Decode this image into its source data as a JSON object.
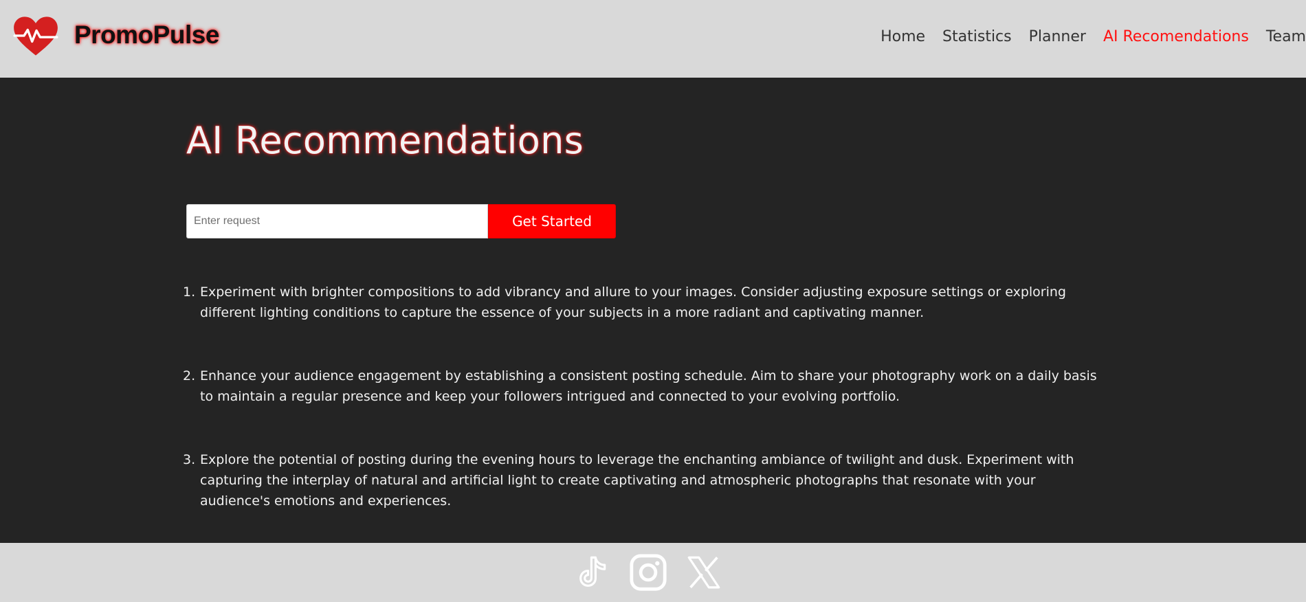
{
  "header": {
    "brand": "PromoPulse",
    "nav": [
      {
        "label": "Home",
        "active": false
      },
      {
        "label": "Statistics",
        "active": false
      },
      {
        "label": "Planner",
        "active": false
      },
      {
        "label": "AI Recomendations",
        "active": true
      },
      {
        "label": "Team",
        "active": false
      }
    ]
  },
  "main": {
    "title": "AI Recommendations",
    "request_placeholder": "Enter request",
    "request_value": "",
    "submit_label": "Get Started",
    "recommendations": [
      "Experiment with brighter compositions to add vibrancy and allure to your images. Consider adjusting exposure settings or exploring different lighting conditions to capture the essence of your subjects in a more radiant and captivating manner.",
      "Enhance your audience engagement by establishing a consistent posting schedule. Aim to share your photography work on a daily basis to maintain a regular presence and keep your followers intrigued and connected to your evolving portfolio.",
      "Explore the potential of posting during the evening hours to leverage the enchanting ambiance of twilight and dusk. Experiment with capturing the interplay of natural and artificial light to create captivating and atmospheric photographs that resonate with your audience's emotions and experiences."
    ]
  },
  "footer": {
    "social_icons": [
      "tiktok-icon",
      "instagram-icon",
      "x-icon"
    ]
  },
  "colors": {
    "accent": "#ff0000",
    "header_bg": "#d9d9d9",
    "main_bg": "#242424",
    "text_light": "#f0f0f0"
  }
}
